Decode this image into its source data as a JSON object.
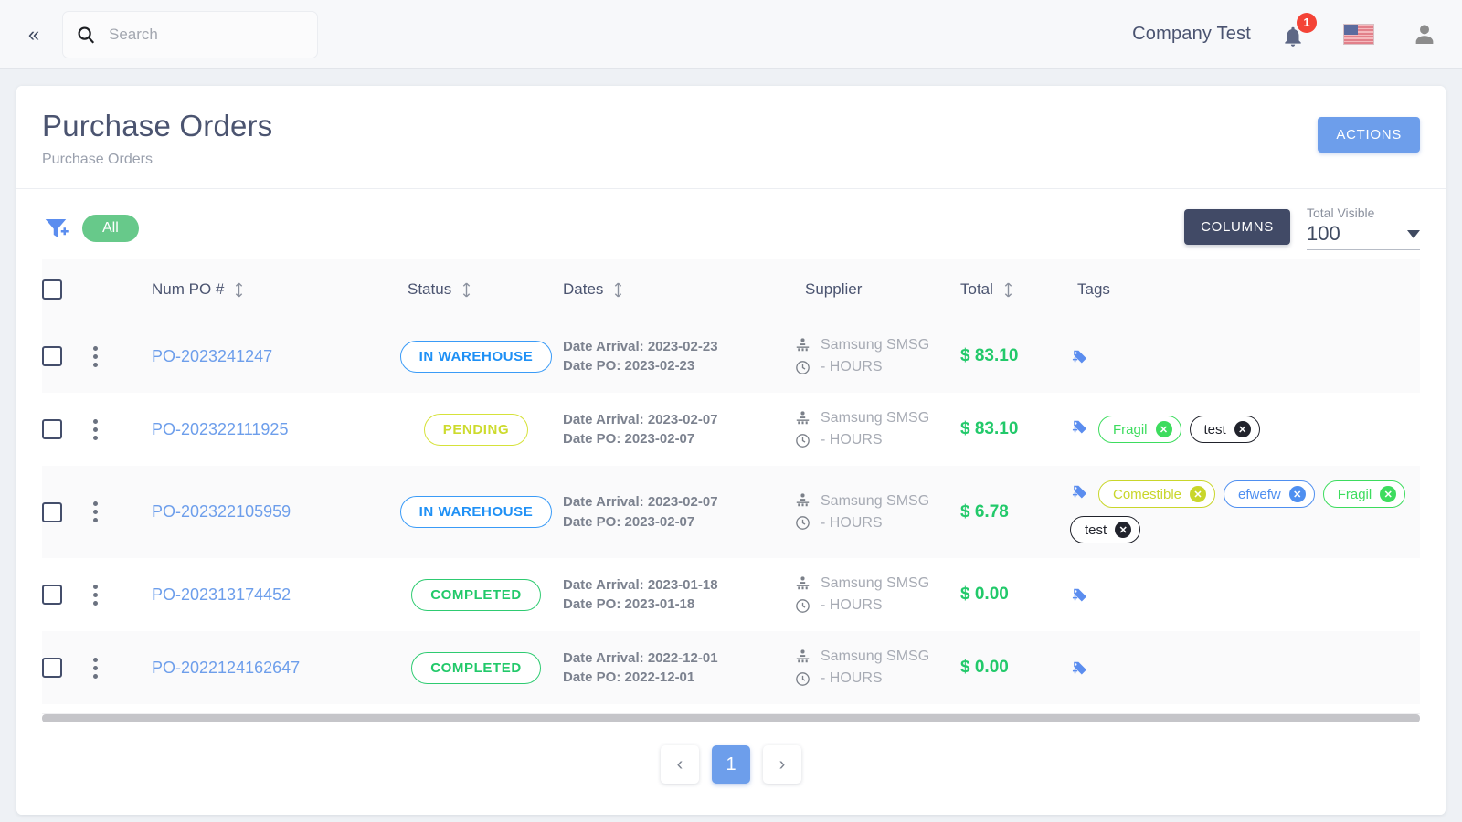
{
  "topbar": {
    "collapse_icon": "chevron-double-left-icon",
    "search_placeholder": "Search",
    "search_value": "",
    "company_name": "Company Test",
    "notification_count": "1",
    "bell_icon": "bell-icon",
    "flag_icon": "us-flag-icon",
    "user_icon": "user-avatar-icon"
  },
  "header": {
    "title": "Purchase Orders",
    "subtitle": "Purchase Orders",
    "actions_label": "ACTIONS"
  },
  "toolbar": {
    "filter_icon": "filter-add-icon",
    "filter_chip_label": "All",
    "columns_label": "COLUMNS",
    "total_visible_label": "Total Visible",
    "total_visible_value": "100"
  },
  "table": {
    "columns": [
      {
        "key": "check",
        "label": "",
        "sortable": false
      },
      {
        "key": "menu",
        "label": "",
        "sortable": false
      },
      {
        "key": "po",
        "label": "Num PO #",
        "sortable": true
      },
      {
        "key": "status",
        "label": "Status",
        "sortable": true
      },
      {
        "key": "dates",
        "label": "Dates",
        "sortable": true
      },
      {
        "key": "sup",
        "label": "Supplier",
        "sortable": false
      },
      {
        "key": "total",
        "label": "Total",
        "sortable": true
      },
      {
        "key": "tags",
        "label": "Tags",
        "sortable": false
      }
    ],
    "rows": [
      {
        "po": "PO-2023241247",
        "status": "IN WAREHOUSE",
        "status_kind": "warehouse",
        "date_arrival": "Date Arrival: 2023-02-23",
        "date_po": "Date PO: 2023-02-23",
        "supplier": "Samsung SMSG",
        "hours": "- HOURS",
        "total": "$ 83.10",
        "tags": []
      },
      {
        "po": "PO-202322111925",
        "status": "PENDING",
        "status_kind": "pending",
        "date_arrival": "Date Arrival: 2023-02-07",
        "date_po": "Date PO: 2023-02-07",
        "supplier": "Samsung SMSG",
        "hours": "- HOURS",
        "total": "$ 83.10",
        "tags": [
          {
            "label": "Fragil",
            "color": "#3ddc5e"
          },
          {
            "label": "test",
            "color": "#21232c"
          }
        ]
      },
      {
        "po": "PO-202322105959",
        "status": "IN WAREHOUSE",
        "status_kind": "warehouse",
        "date_arrival": "Date Arrival: 2023-02-07",
        "date_po": "Date PO: 2023-02-07",
        "supplier": "Samsung SMSG",
        "hours": "- HOURS",
        "total": "$ 6.78",
        "tags": [
          {
            "label": "Comestible",
            "color": "#c9d62b"
          },
          {
            "label": "efwefw",
            "color": "#4f8ff0"
          },
          {
            "label": "Fragil",
            "color": "#3ddc5e"
          },
          {
            "label": "test",
            "color": "#21232c"
          }
        ]
      },
      {
        "po": "PO-202313174452",
        "status": "COMPLETED",
        "status_kind": "completed",
        "date_arrival": "Date Arrival: 2023-01-18",
        "date_po": "Date PO: 2023-01-18",
        "supplier": "Samsung SMSG",
        "hours": "- HOURS",
        "total": "$ 0.00",
        "tags": []
      },
      {
        "po": "PO-2022124162647",
        "status": "COMPLETED",
        "status_kind": "completed",
        "date_arrival": "Date Arrival: 2022-12-01",
        "date_po": "Date PO: 2022-12-01",
        "supplier": "Samsung SMSG",
        "hours": "- HOURS",
        "total": "$ 0.00",
        "tags": []
      }
    ]
  },
  "pagination": {
    "prev_label": "‹",
    "next_label": "›",
    "pages": [
      "1"
    ],
    "current": "1"
  },
  "colors": {
    "accent": "#6d9eeb",
    "dark": "#414a66",
    "green": "#22c96a",
    "badge_red": "#f44336"
  }
}
